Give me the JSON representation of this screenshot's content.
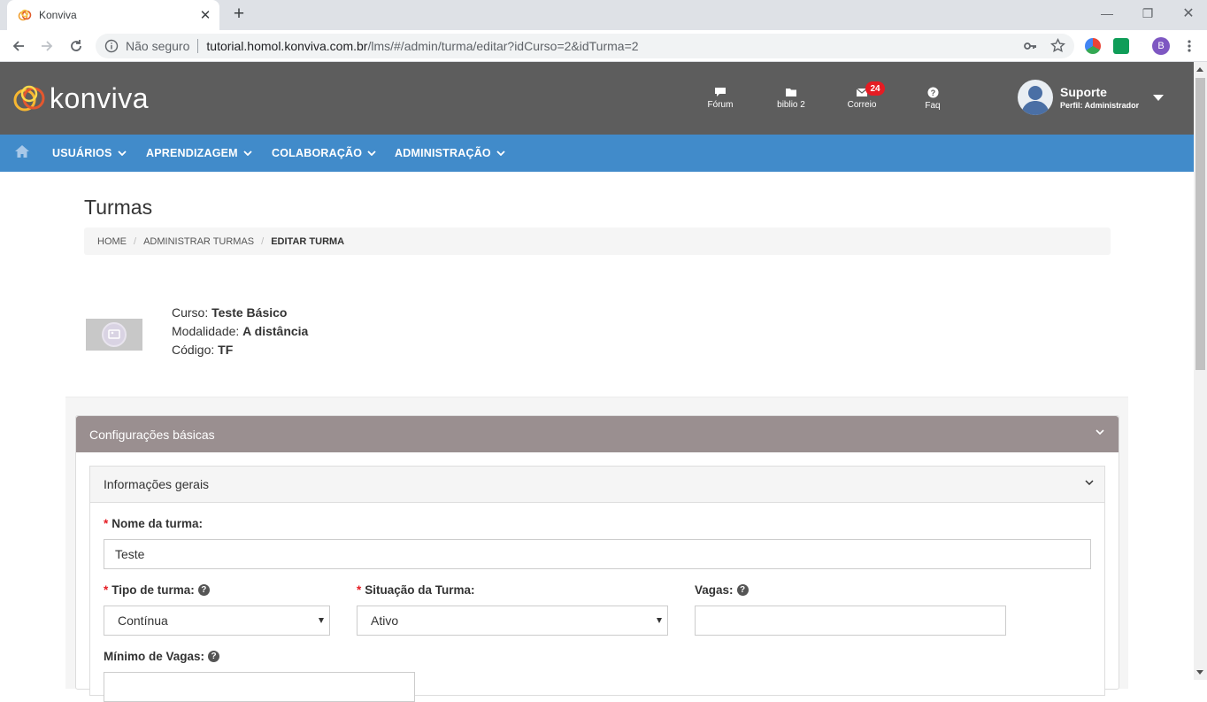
{
  "browser": {
    "tab_title": "Konviva",
    "url_security": "Não seguro",
    "url_host": "tutorial.homol.konviva.com.br",
    "url_path": "/lms/#/admin/turma/editar?idCurso=2&idTurma=2",
    "profile_initial": "B"
  },
  "header": {
    "logo_text": "konviva",
    "icons": [
      {
        "label": "Fórum",
        "icon": "comment-icon"
      },
      {
        "label": "biblio 2",
        "icon": "folder-icon"
      },
      {
        "label": "Correio",
        "icon": "envelope-icon",
        "badge": "24"
      },
      {
        "label": "Faq",
        "icon": "question-icon"
      }
    ],
    "user": {
      "name": "Suporte",
      "role": "Perfil: Administrador"
    }
  },
  "nav": {
    "items": [
      "USUÁRIOS",
      "APRENDIZAGEM",
      "COLABORAÇÃO",
      "ADMINISTRAÇÃO"
    ]
  },
  "page": {
    "title": "Turmas",
    "breadcrumb": [
      "HOME",
      "ADMINISTRAR TURMAS",
      "EDITAR TURMA"
    ]
  },
  "course": {
    "curso_label": "Curso:",
    "curso_value": "Teste Básico",
    "modalidade_label": "Modalidade:",
    "modalidade_value": "A distância",
    "codigo_label": "Código:",
    "codigo_value": "TF"
  },
  "panel": {
    "title": "Configurações básicas",
    "section_title": "Informações gerais",
    "fields": {
      "nome_label": "Nome da turma:",
      "nome_value": "Teste",
      "tipo_label": "Tipo de turma:",
      "tipo_value": "Contínua",
      "situacao_label": "Situação da Turma:",
      "situacao_value": "Ativo",
      "vagas_label": "Vagas:",
      "vagas_value": "",
      "minimo_label": "Mínimo de Vagas:"
    }
  },
  "colors": {
    "header_bg": "#5d5d5d",
    "nav_bg": "#418bca",
    "panel_head_bg": "#9a8f90",
    "badge": "#e51c23"
  }
}
